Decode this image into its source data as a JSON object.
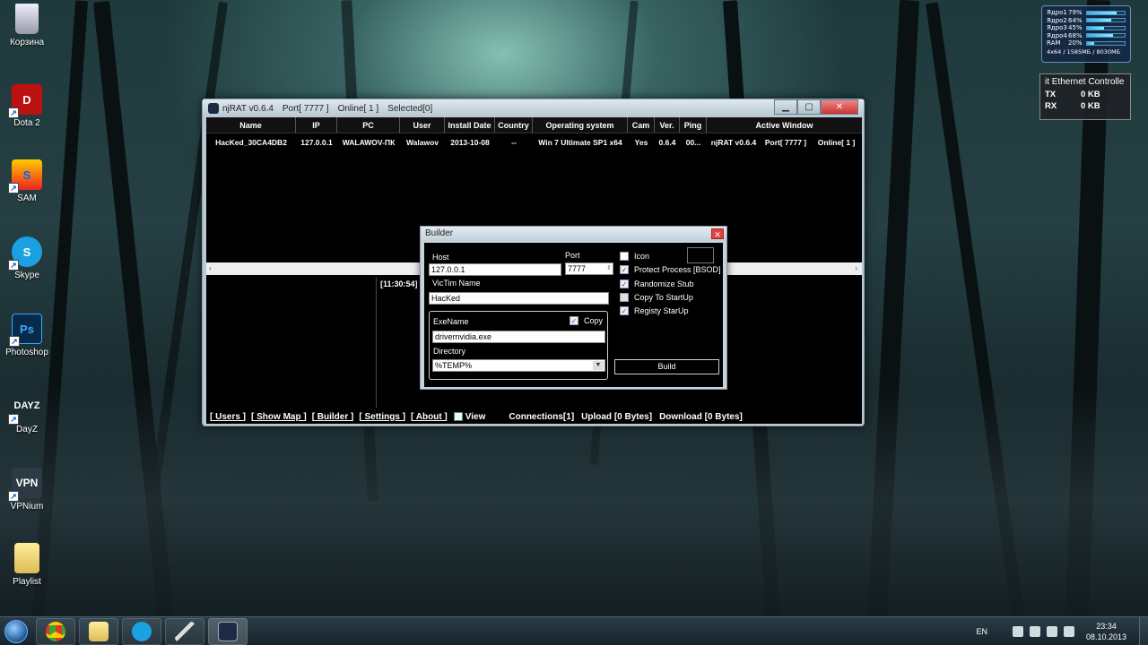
{
  "desktop": {
    "icons": [
      {
        "label": "Корзина",
        "icon": "recycle-bin-icon"
      },
      {
        "label": "Dota 2",
        "icon": "dota2-icon"
      },
      {
        "label": "SAM",
        "icon": "sam-icon"
      },
      {
        "label": "Skype",
        "icon": "skype-icon"
      },
      {
        "label": "Photoshop",
        "icon": "photoshop-icon",
        "glyph": "Ps"
      },
      {
        "label": "DayZ",
        "icon": "dayz-icon",
        "glyph": "DAYZ"
      },
      {
        "label": "VPNium",
        "icon": "vpn-icon",
        "glyph": "VPN"
      },
      {
        "label": "Playlist",
        "icon": "folder-icon"
      }
    ]
  },
  "cpu_gadget": {
    "rows": [
      {
        "name": "Ядро1",
        "pct": "79%",
        "level": 79
      },
      {
        "name": "Ядро2",
        "pct": "64%",
        "level": 64
      },
      {
        "name": "Ядро3",
        "pct": "45%",
        "level": 45
      },
      {
        "name": "Ядро4",
        "pct": "68%",
        "level": 68
      },
      {
        "name": "RAM",
        "pct": "20%",
        "level": 20
      }
    ],
    "footer": "4x64 / 1585МБ / 8030МБ"
  },
  "net_gadget": {
    "title": "it Ethernet Controlle",
    "tx_label": "TX",
    "tx_value": "0 KB",
    "rx_label": "RX",
    "rx_value": "0 KB"
  },
  "njrat": {
    "title": "njRAT v0.6.4",
    "port": "Port[ 7777 ]",
    "online": "Online[ 1 ]",
    "selected": "Selected[0]",
    "columns": [
      "Name",
      "IP",
      "PC",
      "User",
      "Install Date",
      "Country",
      "Operating system",
      "Cam",
      "Ver.",
      "Ping",
      "Active Window"
    ],
    "row": {
      "name": "HacKed_30CA4DB2",
      "ip": "127.0.0.1",
      "pc": "WALAWOV-ПК",
      "user": "Walawov",
      "install_date": "2013-10-08",
      "country": "--",
      "os": "Win 7 Ultimate SP1 x64",
      "cam": "Yes",
      "ver": "0.6.4",
      "ping": "00...",
      "active_window": "njRAT v0.6.4",
      "port_col": "Port[ 7777 ]",
      "online_col": "Online[ 1 ]"
    },
    "log_time": "[11:30:54]",
    "links": [
      "[ Users ]",
      "[ Show Map ]",
      "[ Builder ]",
      "[ Settings ]",
      "[ About ]"
    ],
    "view_label": "View",
    "status": {
      "connections": "Connections[1]",
      "upload": "Upload [0 Bytes]",
      "download": "Download [0 Bytes]"
    }
  },
  "builder": {
    "title": "Builder",
    "host_label": "Host",
    "host_value": "127.0.0.1",
    "port_label": "Port",
    "port_value": "7777",
    "victim_label": "VicTim Name",
    "victim_value": "HacKed",
    "exename_label": "ExeName",
    "copy_label": "Copy",
    "exename_value": "drivernvidia.exe",
    "directory_label": "Directory",
    "directory_value": "%TEMP%",
    "options": [
      {
        "label": "Icon",
        "checked": false
      },
      {
        "label": "Protect Process [BSOD]",
        "checked": true
      },
      {
        "label": "Randomize Stub",
        "checked": true
      },
      {
        "label": "Copy To StartUp",
        "checked": false
      },
      {
        "label": "Registy StarUp",
        "checked": true
      }
    ],
    "build_label": "Build"
  },
  "taskbar": {
    "lang": "EN",
    "time": "23:34",
    "date": "08.10.2013"
  }
}
